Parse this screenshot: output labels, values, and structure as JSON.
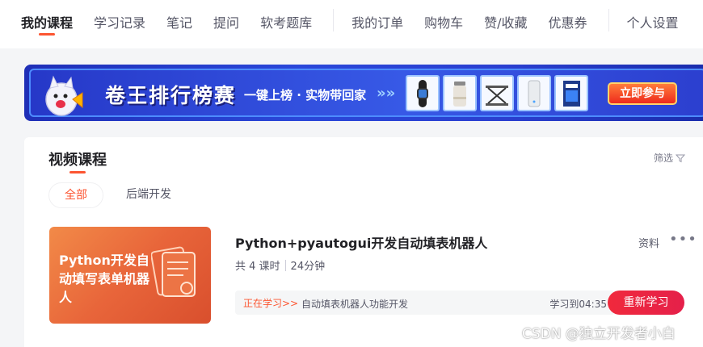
{
  "nav": {
    "items": [
      {
        "label": "我的课程",
        "active": true
      },
      {
        "label": "学习记录"
      },
      {
        "label": "笔记"
      },
      {
        "label": "提问"
      },
      {
        "label": "软考题库"
      },
      {
        "label": "我的订单"
      },
      {
        "label": "购物车"
      },
      {
        "label": "赞/收藏"
      },
      {
        "label": "优惠券"
      },
      {
        "label": "个人设置"
      }
    ]
  },
  "banner": {
    "title": "卷王排行榜赛",
    "subtitle": "一键上榜 · 实物带回家",
    "arrows": "»»",
    "join_label": "立即参与",
    "products": [
      "smart-band",
      "thermos-cup",
      "laptop-stand",
      "power-bank",
      "book"
    ]
  },
  "section": {
    "title": "视频课程",
    "filter_label": "筛选",
    "tabs": [
      {
        "label": "全部",
        "active": true
      },
      {
        "label": "后端开发"
      }
    ]
  },
  "course": {
    "thumb_text": "Python开发自动填写表单机器人",
    "title": "Python+pyautogui开发自动填表机器人",
    "lessons": "共 4 课时",
    "duration": "24分钟",
    "materials_label": "资料",
    "more_label": "•••",
    "studying_label": "正在学习>>",
    "current_lesson": "自动填表机器人功能开发",
    "progress_text": "学习到04:35",
    "restudy_label": "重新学习"
  },
  "watermark": "CSDN @独立开发者小白",
  "colors": {
    "accent": "#fc5531",
    "restudy": "#e5204a",
    "banner": "#2a47d9"
  }
}
